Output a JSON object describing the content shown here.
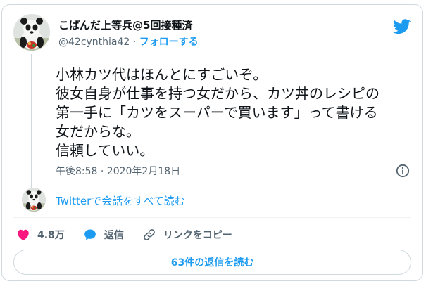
{
  "author": {
    "display_name": "こぱんだ上等兵@5回接種済",
    "handle": "@42cynthia42",
    "separator": " · ",
    "follow_label": "フォローする"
  },
  "tweet": {
    "lines": [
      "小林カツ代はほんとにすごいぞ。",
      "彼女自身が仕事を持つ女だから、カツ丼のレシピの",
      "第一手に「カツをスーパーで買います」って書ける",
      "女だからな。",
      "信頼していい。"
    ],
    "timestamp": "午後8:58 · 2020年2月18日"
  },
  "conversation": {
    "read_all_label": "Twitterで会話をすべて読む"
  },
  "actions": {
    "like_count": "4.8万",
    "reply_label": "返信",
    "copy_link_label": "リンクをコピー"
  },
  "footer": {
    "read_replies_label": "63件の返信を読む"
  },
  "colors": {
    "accent": "#1d9bf0",
    "like": "#f91880",
    "muted": "#536471",
    "text": "#0f1419",
    "border": "#cfd9de"
  },
  "icons": {
    "brand": "twitter-bird-icon",
    "info": "info-icon",
    "like": "heart-icon",
    "reply": "speech-bubble-icon",
    "copy_link": "link-icon"
  }
}
